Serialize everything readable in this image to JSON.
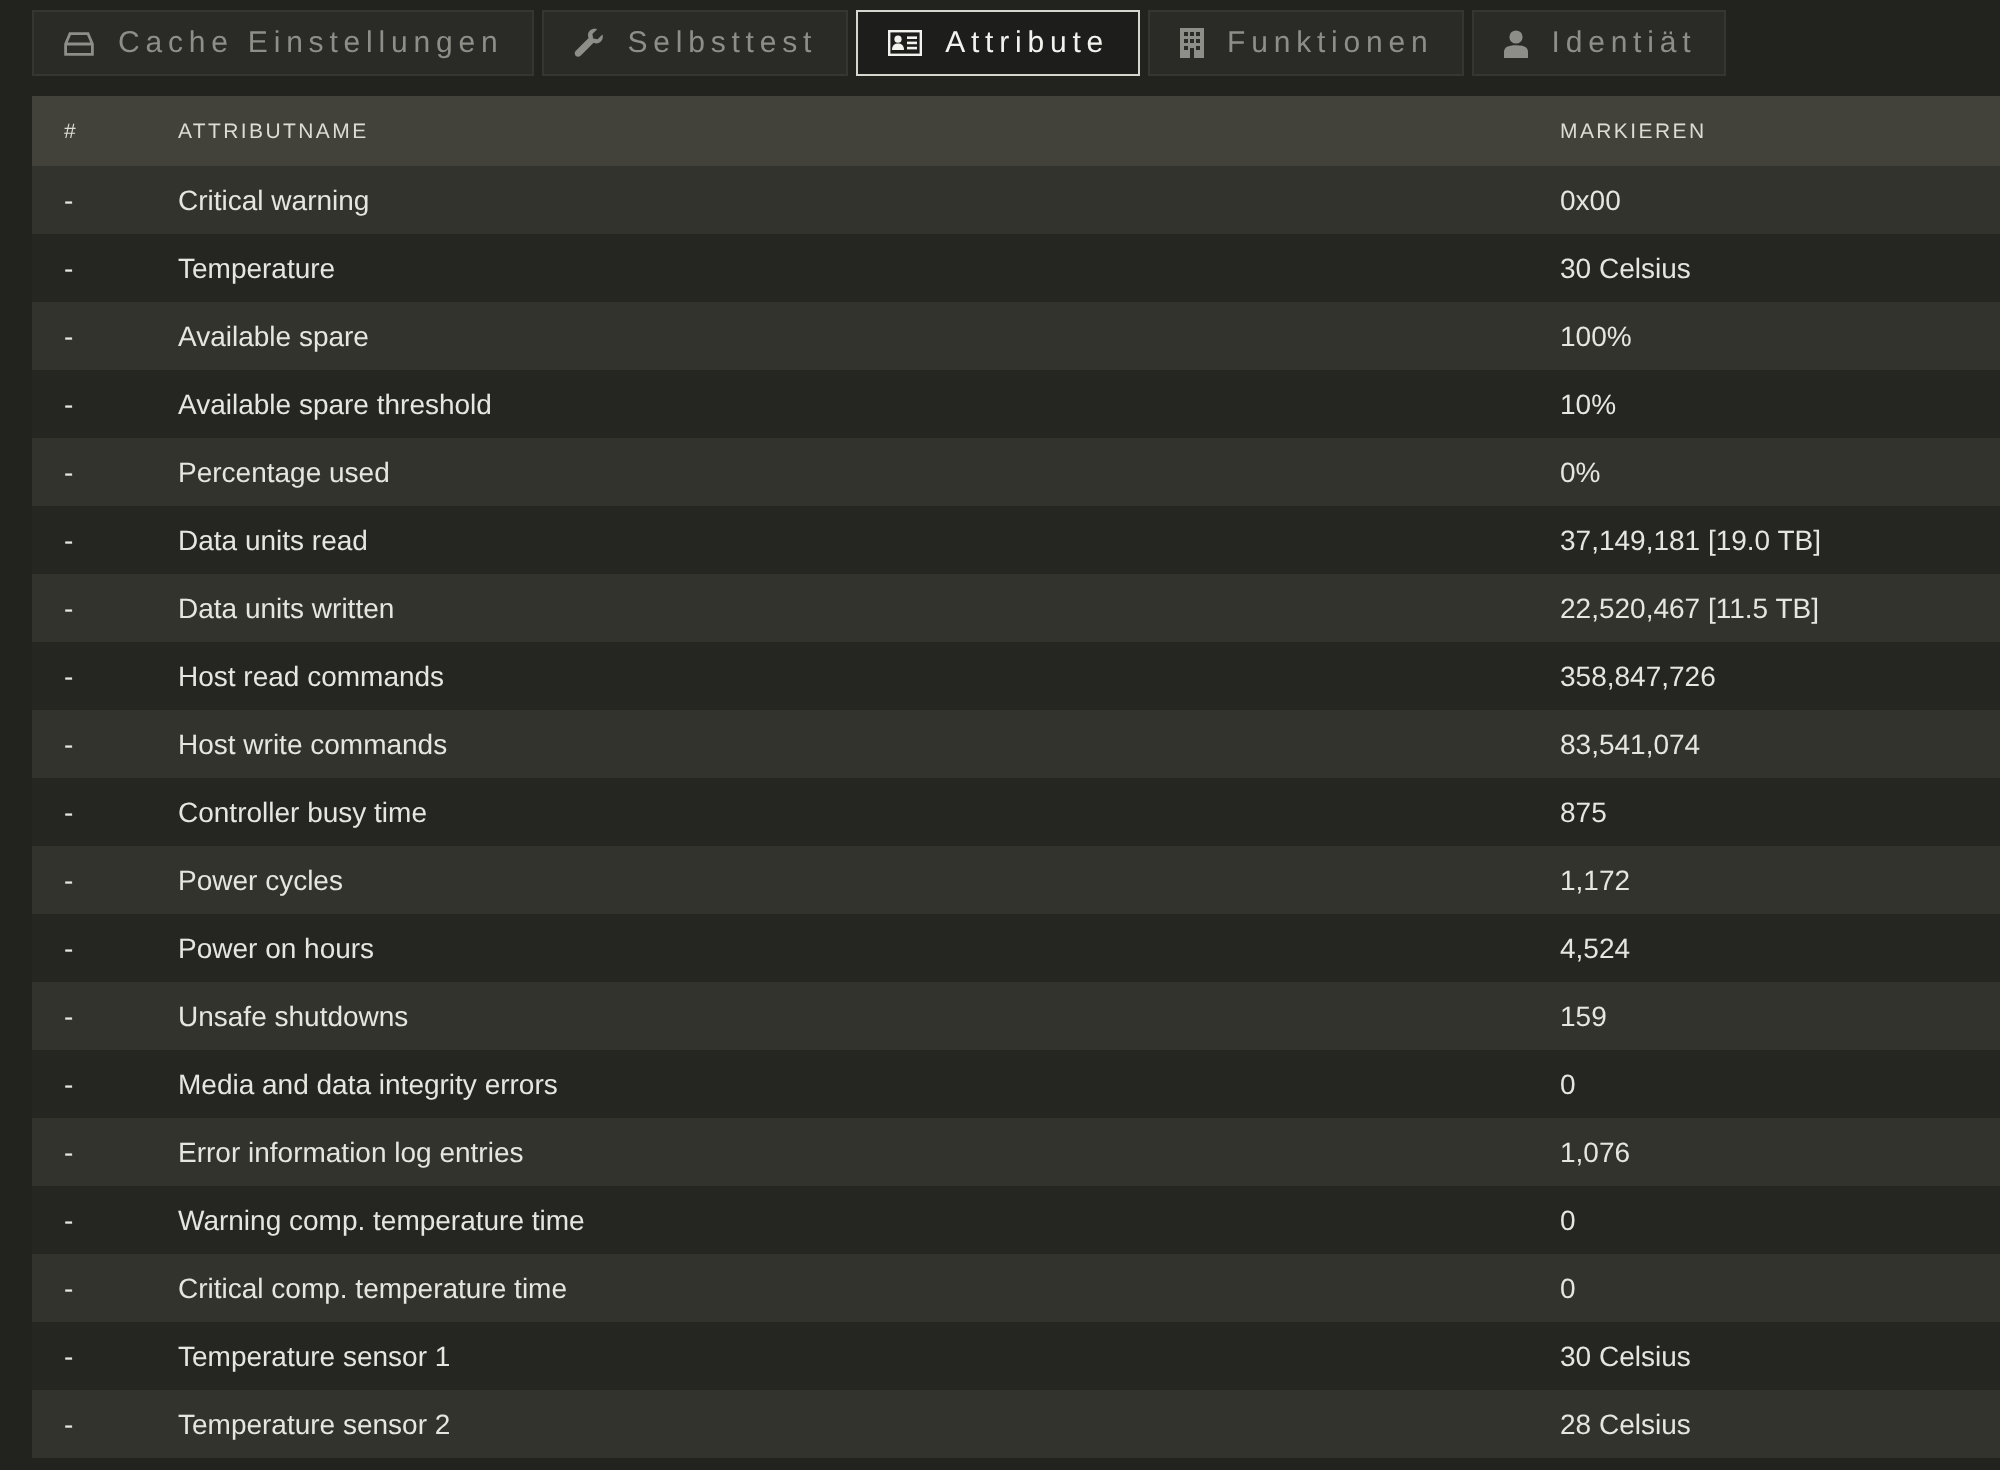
{
  "tabs": [
    {
      "label": "Cache Einstellungen",
      "selected": false
    },
    {
      "label": "Selbsttest",
      "selected": false
    },
    {
      "label": "Attribute",
      "selected": true
    },
    {
      "label": "Funktionen",
      "selected": false
    },
    {
      "label": "Identiät",
      "selected": false
    }
  ],
  "table": {
    "columns": [
      "#",
      "ATTRIBUTNAME",
      "MARKIEREN"
    ],
    "rows": [
      {
        "index": "-",
        "name": "Critical warning",
        "value": "0x00"
      },
      {
        "index": "-",
        "name": "Temperature",
        "value": "30 Celsius"
      },
      {
        "index": "-",
        "name": "Available spare",
        "value": "100%"
      },
      {
        "index": "-",
        "name": "Available spare threshold",
        "value": "10%"
      },
      {
        "index": "-",
        "name": "Percentage used",
        "value": "0%"
      },
      {
        "index": "-",
        "name": "Data units read",
        "value": "37,149,181 [19.0 TB]"
      },
      {
        "index": "-",
        "name": "Data units written",
        "value": "22,520,467 [11.5 TB]"
      },
      {
        "index": "-",
        "name": "Host read commands",
        "value": "358,847,726"
      },
      {
        "index": "-",
        "name": "Host write commands",
        "value": "83,541,074"
      },
      {
        "index": "-",
        "name": "Controller busy time",
        "value": "875"
      },
      {
        "index": "-",
        "name": "Power cycles",
        "value": "1,172"
      },
      {
        "index": "-",
        "name": "Power on hours",
        "value": "4,524"
      },
      {
        "index": "-",
        "name": "Unsafe shutdowns",
        "value": "159"
      },
      {
        "index": "-",
        "name": "Media and data integrity errors",
        "value": "0"
      },
      {
        "index": "-",
        "name": "Error information log entries",
        "value": "1,076"
      },
      {
        "index": "-",
        "name": "Warning comp. temperature time",
        "value": "0"
      },
      {
        "index": "-",
        "name": "Critical comp. temperature time",
        "value": "0"
      },
      {
        "index": "-",
        "name": "Temperature sensor 1",
        "value": "30 Celsius"
      },
      {
        "index": "-",
        "name": "Temperature sensor 2",
        "value": "28 Celsius"
      }
    ]
  }
}
